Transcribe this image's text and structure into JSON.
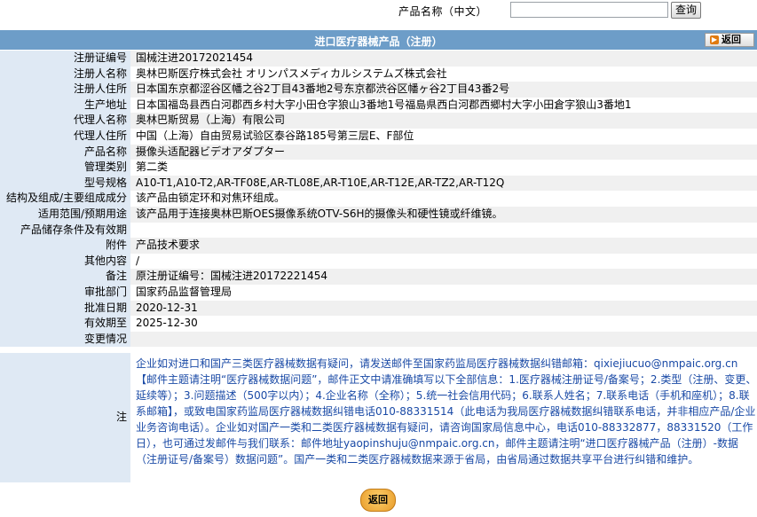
{
  "search": {
    "label": "产品名称（中文）",
    "input_value": "",
    "button_label": "查询"
  },
  "header": {
    "title": "进口医疗器械产品（注册）",
    "back_label": "返回",
    "back_icon": "arrow-right-icon"
  },
  "fields": [
    {
      "label": "注册证编号",
      "value": "国械注进20172021454"
    },
    {
      "label": "注册人名称",
      "value": "奥林巴斯医疗株式会社 オリンパスメディカルシステムズ株式会社"
    },
    {
      "label": "注册人住所",
      "value": "日本国东京都涩谷区幡之谷2丁目43番地2号东京都渋谷区幡ヶ谷2丁目43番2号"
    },
    {
      "label": "生产地址",
      "value": "日本国福岛县西白河郡西乡村大字小田仓字狼山3番地1号福島県西白河郡西郷村大字小田倉字狼山3番地1"
    },
    {
      "label": "代理人名称",
      "value": "奥林巴斯贸易（上海）有限公司"
    },
    {
      "label": "代理人住所",
      "value": "中国（上海）自由贸易试验区泰谷路185号第三层E、F部位"
    },
    {
      "label": "产品名称",
      "value": "摄像头适配器ビデオアダプター"
    },
    {
      "label": "管理类别",
      "value": "第二类"
    },
    {
      "label": "型号规格",
      "value": "A10-T1,A10-T2,AR-TF08E,AR-TL08E,AR-T10E,AR-T12E,AR-TZ2,AR-T12Q"
    },
    {
      "label": "结构及组成/主要组成成分",
      "value": "该产品由锁定环和对焦环组成。"
    },
    {
      "label": "适用范围/预期用途",
      "value": "该产品用于连接奥林巴斯OES摄像系统OTV-S6H的摄像头和硬性镜或纤维镜。"
    },
    {
      "label": "产品储存条件及有效期",
      "value": ""
    },
    {
      "label": "附件",
      "value": "产品技术要求"
    },
    {
      "label": "其他内容",
      "value": "/"
    },
    {
      "label": "备注",
      "value": "原注册证编号：国械注进20172221454"
    },
    {
      "label": "审批部门",
      "value": "国家药品监督管理局"
    },
    {
      "label": "批准日期",
      "value": "2020-12-31"
    },
    {
      "label": "有效期至",
      "value": "2025-12-30"
    },
    {
      "label": "变更情况",
      "value": ""
    }
  ],
  "note": {
    "label": "注",
    "text": "企业如对进口和国产三类医疗器械数据有疑问，请发送邮件至国家药监局医疗器械数据纠错邮箱：qixiejiucuo@nmpaic.org.cn【邮件主题请注明“医疗器械数据问题”，邮件正文中请准确填写以下全部信息：1.医疗器械注册证号/备案号；2.类型（注册、变更、延续等）；3.问题描述（500字以内）；4.企业名称（全称）；5.统一社会信用代码；6.联系人姓名；7.联系电话（手机和座机）；8.联系邮箱】，或致电国家药监局医疗器械数据纠错电话010-88331514（此电话为我局医疗器械数据纠错联系电话，并非相应产品/企业业务咨询电话）。企业如对国产一类和二类医疗器械数据有疑问，请咨询国家局信息中心，电话010-88332877，88331520（工作日），也可通过发邮件与我们联系：邮件地址yaopinshuju@nmpaic.org.cn，邮件主题请注明“进口医疗器械产品（注册）-数据（注册证号/备案号）数据问题”。国产一类和二类医疗器械数据来源于省局，由省局通过数据共享平台进行纠错和维护。"
  },
  "footer": {
    "back_label": "返回"
  },
  "colors": {
    "header_bg": "#6d9dc8",
    "label_bg": "#dfe9f4",
    "note_text": "#1a4aa6",
    "back_button": "#e79b2a"
  }
}
